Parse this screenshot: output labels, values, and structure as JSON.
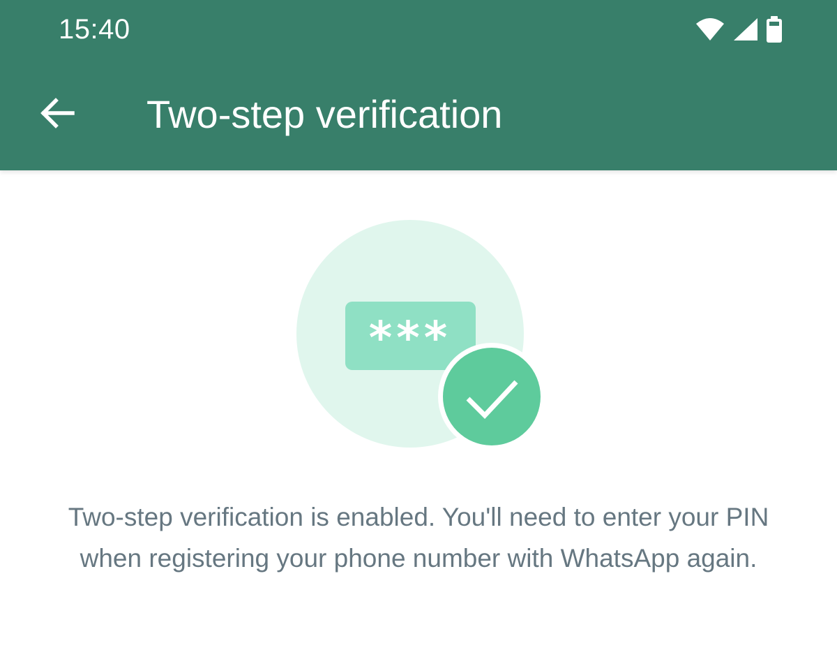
{
  "status_bar": {
    "time": "15:40",
    "icons": [
      "wifi-icon",
      "cellular-signal-icon",
      "battery-icon"
    ]
  },
  "toolbar": {
    "back_icon": "arrow-left-icon",
    "title": "Two-step verification"
  },
  "illustration": {
    "pin_mask": "***",
    "icons": [
      "pin-field-icon",
      "check-circle-icon"
    ]
  },
  "body": {
    "description": "Two-step verification is enabled. You'll need to enter your PIN when registering your phone number with WhatsApp again."
  },
  "colors": {
    "header": "#387f6a",
    "illustration_circle": "#e0f6ed",
    "pin_field": "#8fe0c4",
    "check_badge": "#5ecb9c",
    "description_text": "#667781"
  }
}
